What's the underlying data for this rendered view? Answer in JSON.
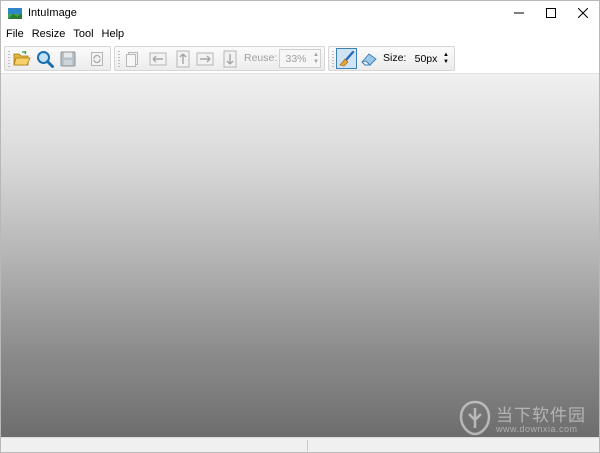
{
  "window": {
    "title": "IntuImage",
    "controls": {
      "minimize": "—",
      "maximize": "☐",
      "close": "✕"
    }
  },
  "menu": [
    {
      "label": "File"
    },
    {
      "label": "Resize"
    },
    {
      "label": "Tool"
    },
    {
      "label": "Help"
    }
  ],
  "toolbar": {
    "reuse_label": "Reuse:",
    "reuse_value": "33%",
    "size_label": "Size:",
    "size_value": "50px"
  },
  "watermark": {
    "text": "当下软件园",
    "url": "www.downxia.com"
  },
  "colors": {
    "brush_active_border": "#3c7fb1",
    "brush_active_bg": "#cfe3f5"
  }
}
